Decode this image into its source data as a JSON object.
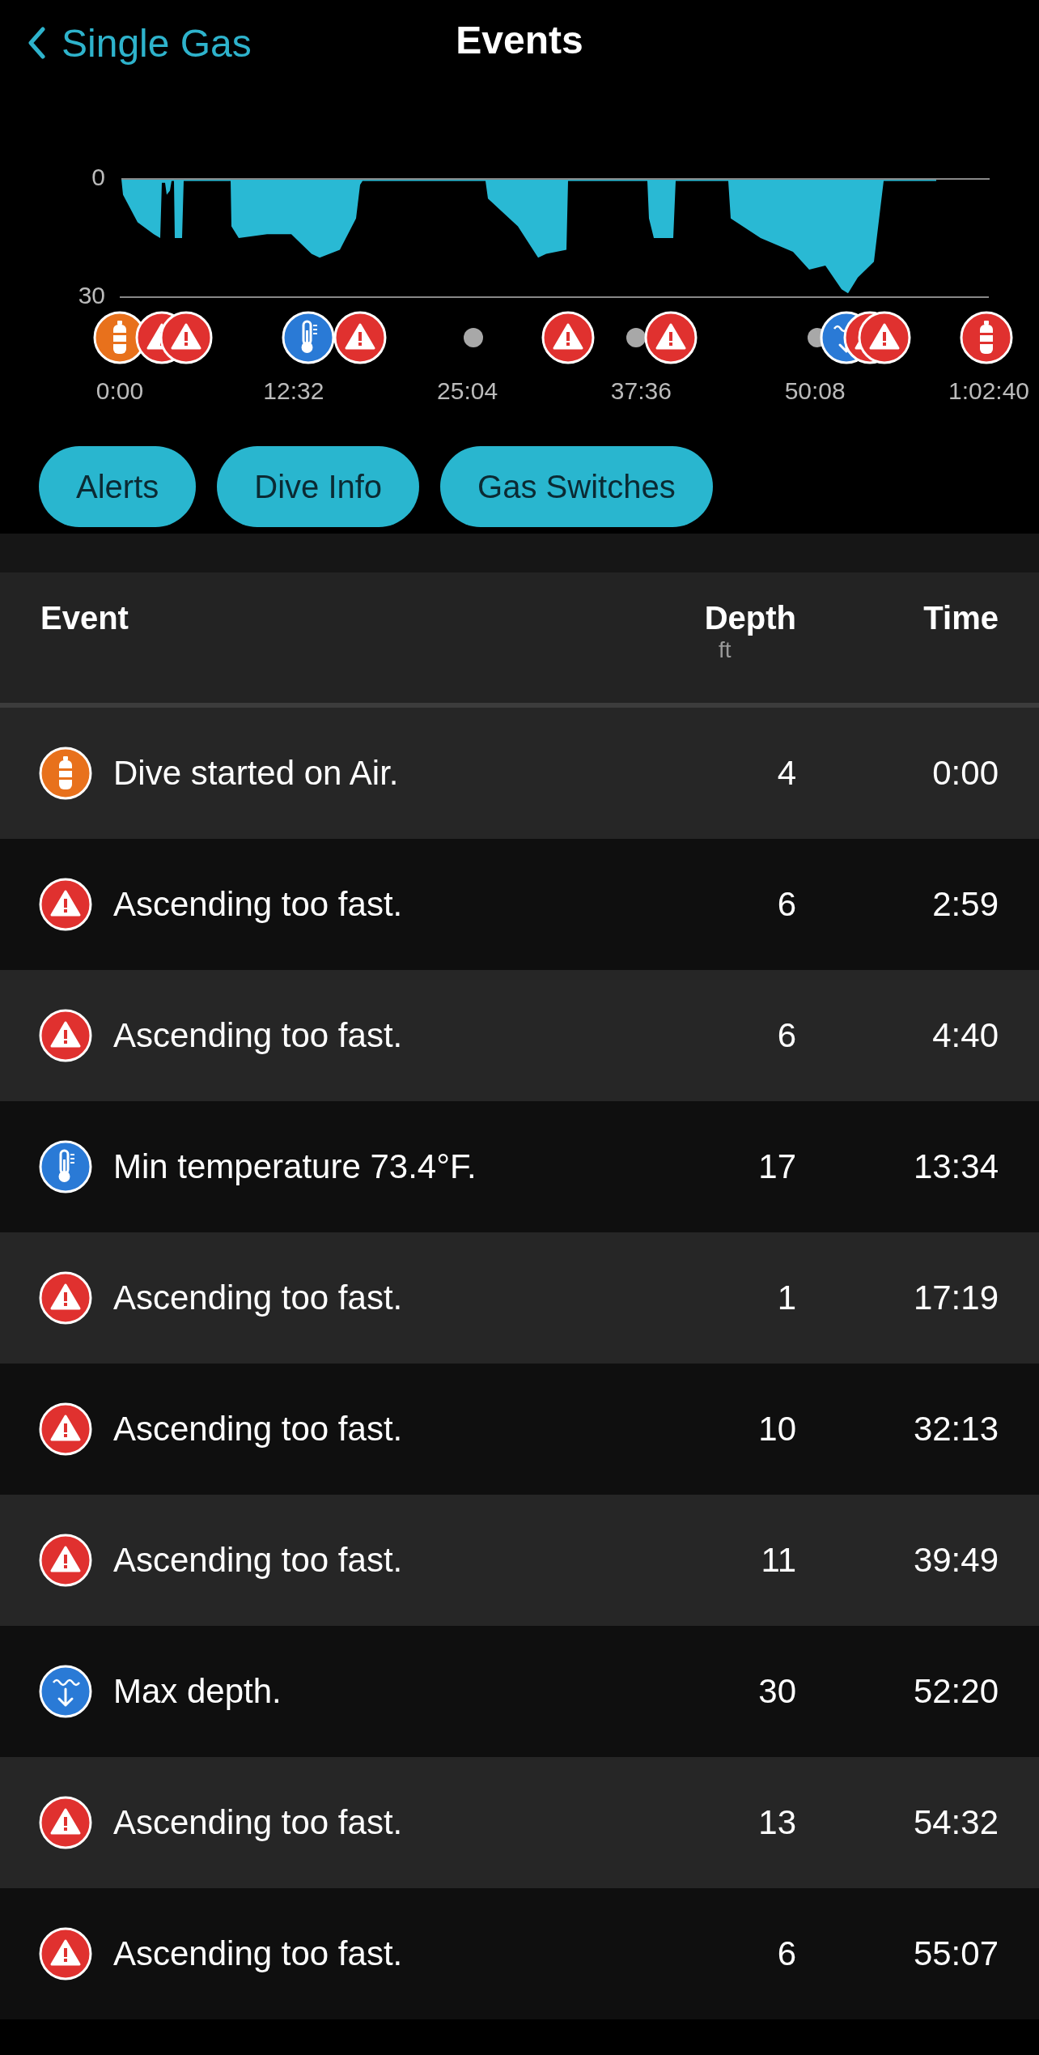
{
  "nav": {
    "back_label": "Single Gas",
    "title": "Events"
  },
  "profile": {
    "y_labels": [
      "0",
      "30"
    ],
    "x_labels": [
      "0:00",
      "12:32",
      "25:04",
      "37:36",
      "50:08",
      "1:02:40"
    ],
    "markers": [
      {
        "kind": "tank",
        "color": "#e8711c",
        "level": 0
      },
      {
        "kind": "alert",
        "color": "#e0312f",
        "level": 0.048
      },
      {
        "kind": "alert",
        "color": "#e0312f",
        "level": 0.076
      },
      {
        "kind": "temperature",
        "color": "#2a7ad6",
        "level": 0.217
      },
      {
        "kind": "alert",
        "color": "#e0312f",
        "level": 0.277
      },
      {
        "kind": "dot",
        "color": "#a8a8a8",
        "level": 0.407
      },
      {
        "kind": "alert",
        "color": "#e0312f",
        "level": 0.516
      },
      {
        "kind": "dot",
        "color": "#a8a8a8",
        "level": 0.594
      },
      {
        "kind": "alert",
        "color": "#e0312f",
        "level": 0.634
      },
      {
        "kind": "dot",
        "color": "#a8a8a8",
        "level": 0.803
      },
      {
        "kind": "maxdepth",
        "color": "#2a7ad6",
        "level": 0.836
      },
      {
        "kind": "alert",
        "color": "#e0312f",
        "level": 0.863
      },
      {
        "kind": "alert",
        "color": "#e0312f",
        "level": 0.88
      },
      {
        "kind": "tank",
        "color": "#e0312f",
        "level": 0.997
      }
    ]
  },
  "filters": [
    "Alerts",
    "Dive Info",
    "Gas Switches"
  ],
  "table": {
    "columns": [
      {
        "label": "Event"
      },
      {
        "label": "Depth",
        "unit": "ft"
      },
      {
        "label": "Time"
      }
    ],
    "rows": [
      {
        "kind": "tank",
        "color": "#e8711c",
        "event": "Dive started on Air.",
        "depth": "4",
        "time": "0:00"
      },
      {
        "kind": "alert",
        "color": "#e0312f",
        "event": "Ascending too fast.",
        "depth": "6",
        "time": "2:59"
      },
      {
        "kind": "alert",
        "color": "#e0312f",
        "event": "Ascending too fast.",
        "depth": "6",
        "time": "4:40"
      },
      {
        "kind": "temperature",
        "color": "#2a7ad6",
        "event": "Min temperature 73.4°F.",
        "depth": "17",
        "time": "13:34"
      },
      {
        "kind": "alert",
        "color": "#e0312f",
        "event": "Ascending too fast.",
        "depth": "1",
        "time": "17:19"
      },
      {
        "kind": "alert",
        "color": "#e0312f",
        "event": "Ascending too fast.",
        "depth": "10",
        "time": "32:13"
      },
      {
        "kind": "alert",
        "color": "#e0312f",
        "event": "Ascending too fast.",
        "depth": "11",
        "time": "39:49"
      },
      {
        "kind": "maxdepth",
        "color": "#2a7ad6",
        "event": "Max depth.",
        "depth": "30",
        "time": "52:20"
      },
      {
        "kind": "alert",
        "color": "#e0312f",
        "event": "Ascending too fast.",
        "depth": "13",
        "time": "54:32"
      },
      {
        "kind": "alert",
        "color": "#e0312f",
        "event": "Ascending too fast.",
        "depth": "6",
        "time": "55:07"
      }
    ]
  }
}
